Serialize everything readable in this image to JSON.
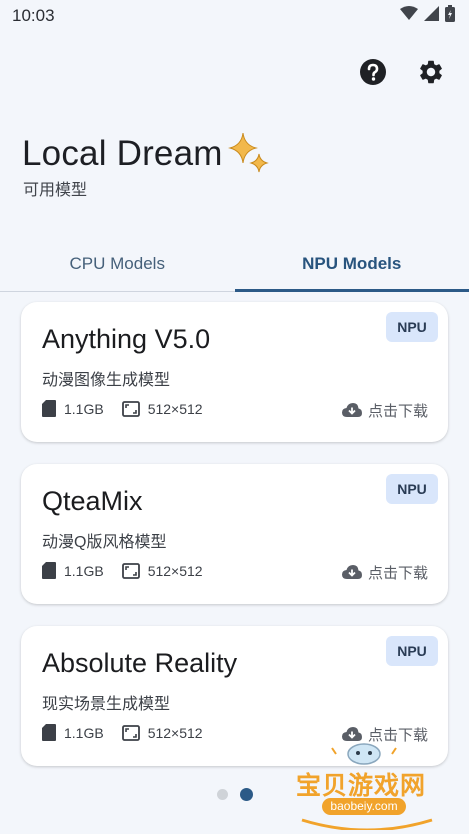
{
  "status_bar": {
    "time": "10:03"
  },
  "header": {
    "title": "Local Dream",
    "subtitle": "可用模型"
  },
  "tabs": [
    {
      "label": "CPU Models",
      "active": false
    },
    {
      "label": "NPU Models",
      "active": true
    }
  ],
  "models": [
    {
      "name": "Anything V5.0",
      "description": "动漫图像生成模型",
      "badge": "NPU",
      "size": "1.1GB",
      "resolution": "512×512",
      "download_label": "点击下载"
    },
    {
      "name": "QteaMix",
      "description": "动漫Q版风格模型",
      "badge": "NPU",
      "size": "1.1GB",
      "resolution": "512×512",
      "download_label": "点击下载"
    },
    {
      "name": "Absolute Reality",
      "description": "现实场景生成模型",
      "badge": "NPU",
      "size": "1.1GB",
      "resolution": "512×512",
      "download_label": "点击下载"
    }
  ],
  "pager": {
    "current_page": 2,
    "page_count": 2
  },
  "watermark": {
    "text": "宝贝游戏网",
    "url": "baobeiy.com"
  },
  "colors": {
    "accent": "#2c5a87",
    "background": "#f3f6fb",
    "badge_bg": "#d9e6fb",
    "sparkle": "#f2b84b"
  }
}
